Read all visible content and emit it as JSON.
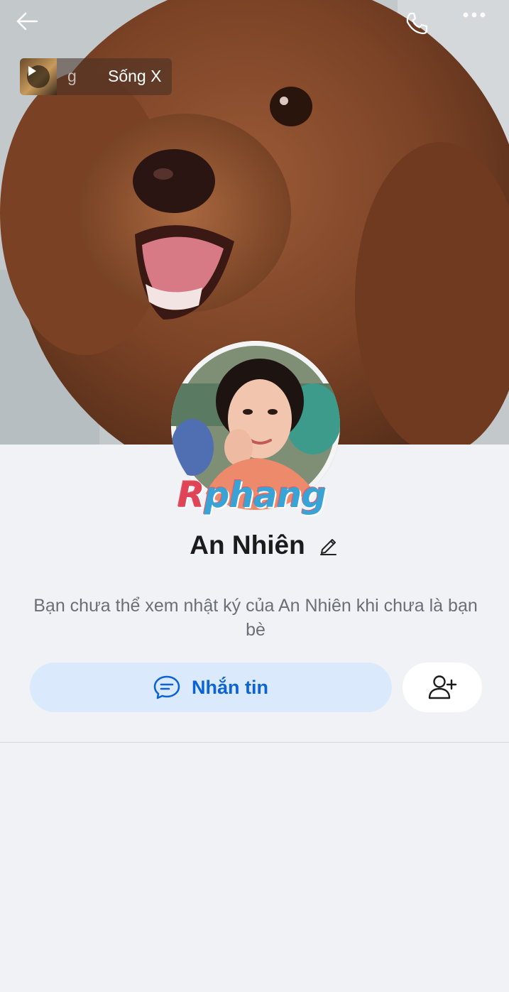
{
  "header": {
    "back_icon": "arrow-left-icon",
    "call_icon": "phone-icon",
    "more_icon": "more-horizontal-icon"
  },
  "music": {
    "text_fragment": "g",
    "song_title": "Sống X",
    "play_icon": "play-icon"
  },
  "profile": {
    "name": "An Nhiên",
    "edit_icon": "pencil-icon",
    "watermark_lead": "R",
    "watermark_rest": "phang"
  },
  "privacy_note": "Bạn chưa thể xem nhật ký của An Nhiên khi chưa là bạn bè",
  "actions": {
    "message_label": "Nhắn tin",
    "message_icon": "chat-bubble-icon",
    "add_friend_icon": "add-user-icon"
  },
  "colors": {
    "page_bg": "#f0f2f5",
    "accent_blue": "#0b63d6",
    "message_btn_bg": "#dbe9fc"
  }
}
